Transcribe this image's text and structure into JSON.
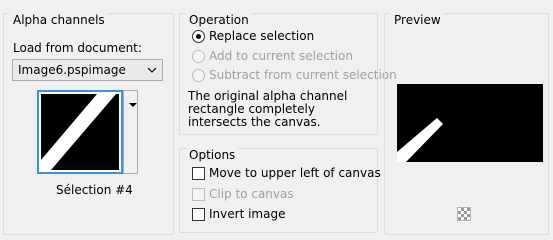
{
  "alpha_channels": {
    "title": "Alpha channels",
    "load_label": "Load from document:",
    "document_value": "Image6.pspimage",
    "selection_caption": "Sélection #4"
  },
  "operation": {
    "title": "Operation",
    "options": [
      {
        "label": "Replace selection",
        "checked": true,
        "enabled": true
      },
      {
        "label": "Add to current selection",
        "checked": false,
        "enabled": false
      },
      {
        "label": "Subtract from current selection",
        "checked": false,
        "enabled": false
      }
    ],
    "description": "The original alpha channel rectangle completely intersects the canvas."
  },
  "options": {
    "title": "Options",
    "items": [
      {
        "label": "Move to upper left of canvas",
        "checked": false,
        "enabled": true
      },
      {
        "label": "Clip to canvas",
        "checked": false,
        "enabled": false
      },
      {
        "label": "Invert image",
        "checked": false,
        "enabled": true
      }
    ]
  },
  "preview": {
    "title": "Preview"
  },
  "colors": {
    "focus_border": "#3d8ee6",
    "preview_bg": "#000000",
    "shape": "#ffffff"
  }
}
